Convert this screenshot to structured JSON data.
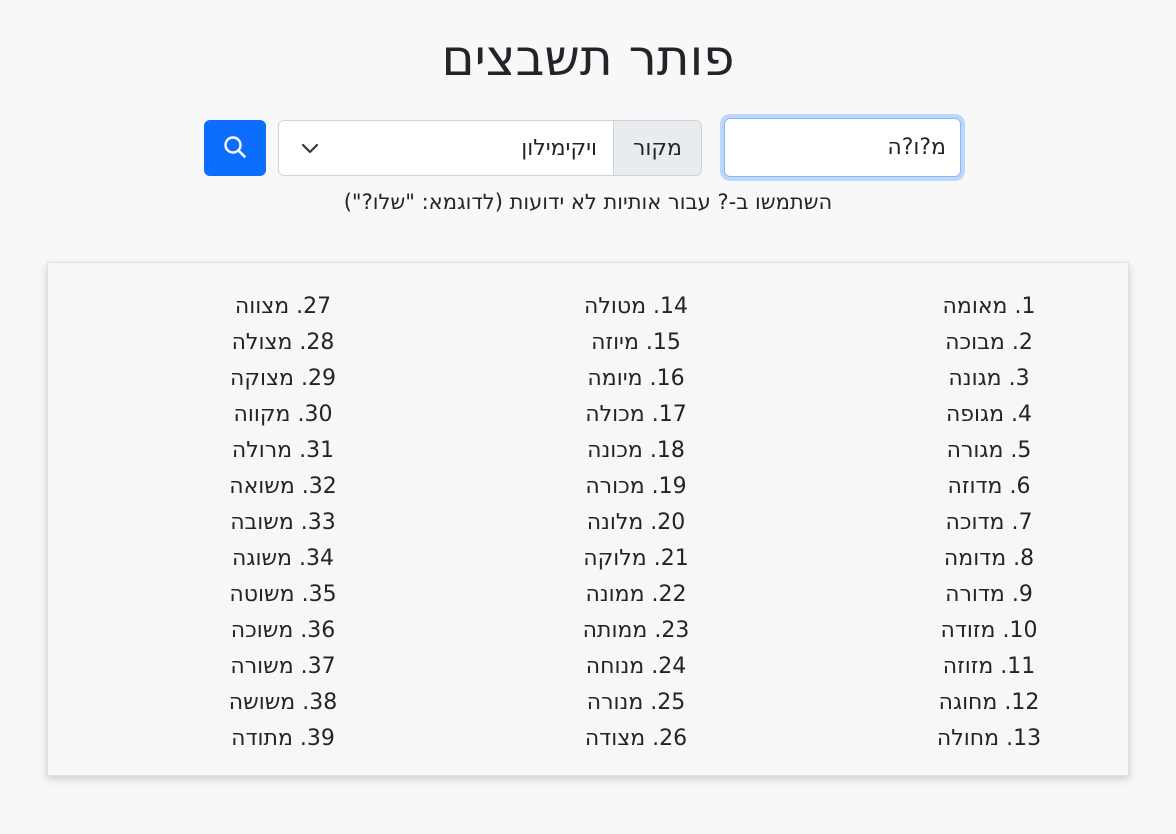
{
  "header": {
    "title": "פותר תשבצים"
  },
  "search": {
    "query_value": "מ?ו?ה",
    "source_label": "מקור",
    "source_selected": "ויקימילון",
    "hint": "השתמשו ב-? עבור אותיות לא ידועות (לדוגמא: \"שלו?\")"
  },
  "icons": {
    "search": "search-icon",
    "dropdown": "chevron-down-icon"
  },
  "colors": {
    "accent": "#0d6efd",
    "background": "#f8f8f8",
    "text": "#212529"
  },
  "results": {
    "columns": [
      [
        "1. מאומה",
        "2. מבוכה",
        "3. מגונה",
        "4. מגופה",
        "5. מגורה",
        "6. מדוזה",
        "7. מדוכה",
        "8. מדומה",
        "9. מדורה",
        "10. מזודה",
        "11. מזוזה",
        "12. מחוגה",
        "13. מחולה"
      ],
      [
        "14. מטולה",
        "15. מיוזה",
        "16. מיומה",
        "17. מכולה",
        "18. מכונה",
        "19. מכורה",
        "20. מלונה",
        "21. מלוקה",
        "22. ממונה",
        "23. ממותה",
        "24. מנוחה",
        "25. מנורה",
        "26. מצודה"
      ],
      [
        "27. מצווה",
        "28. מצולה",
        "29. מצוקה",
        "30. מקווה",
        "31. מרולה",
        "32. משואה",
        "33. משובה",
        "34. משוגה",
        "35. משוטה",
        "36. משוכה",
        "37. משורה",
        "38. משושה",
        "39. מתודה"
      ]
    ]
  }
}
